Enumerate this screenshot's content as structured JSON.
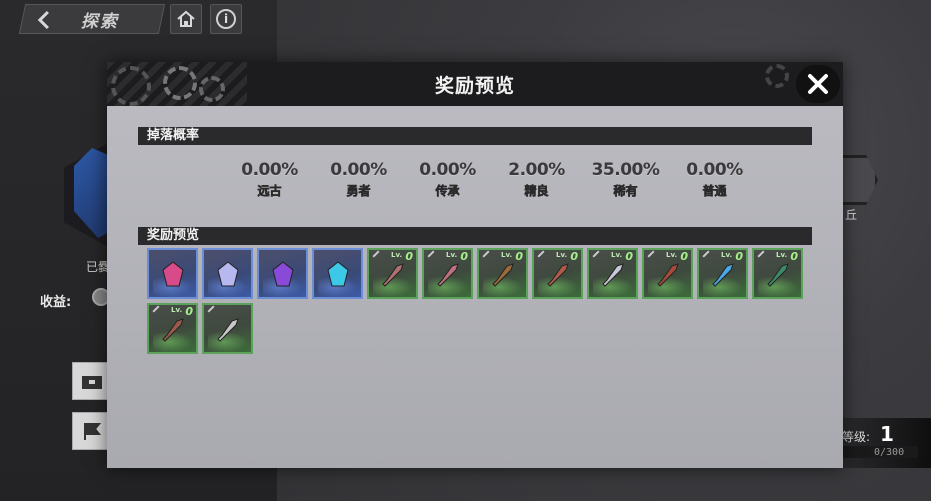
{
  "background": {
    "back_label": "探索",
    "status_text": "已爨",
    "income_label": "收益:",
    "right_label": "丘",
    "level_label": "等级:",
    "level_value": "1",
    "level_exp": "0/300"
  },
  "dialog": {
    "title": "奖励预览",
    "drop_section_label": "掉落概率",
    "reward_section_label": "奖励预览",
    "rates": [
      {
        "value": "0.00%",
        "name": "远古",
        "color": "#f0a21e"
      },
      {
        "value": "0.00%",
        "name": "勇者",
        "color": "#f0c21e"
      },
      {
        "value": "0.00%",
        "name": "传承",
        "color": "#b45ae8"
      },
      {
        "value": "2.00%",
        "name": "精良",
        "color": "#5aa84e"
      },
      {
        "value": "35.00%",
        "name": "稀有",
        "color": "#4f86e8"
      },
      {
        "value": "0.00%",
        "name": "普通",
        "color": "#d8d8d8"
      }
    ],
    "items": [
      {
        "tier": "rare",
        "icon": "red-crystal-icon",
        "color": "#d84a8a",
        "lv": "",
        "count": ""
      },
      {
        "tier": "rare",
        "icon": "white-crystal-icon",
        "color": "#b8b8f0",
        "lv": "",
        "count": ""
      },
      {
        "tier": "rare",
        "icon": "purple-crystal-icon",
        "color": "#8a4ad8",
        "lv": "",
        "count": ""
      },
      {
        "tier": "rare",
        "icon": "cyan-crystal-icon",
        "color": "#3ec8e8",
        "lv": "",
        "count": ""
      },
      {
        "tier": "good",
        "icon": "rifle-icon",
        "color": "#b07070",
        "lv": "Lv.",
        "count": "0"
      },
      {
        "tier": "good",
        "icon": "pistol-icon",
        "color": "#c07080",
        "lv": "Lv.",
        "count": "0"
      },
      {
        "tier": "good",
        "icon": "shotgun-icon",
        "color": "#9a6a3a",
        "lv": "Lv.",
        "count": "0"
      },
      {
        "tier": "good",
        "icon": "armor-icon",
        "color": "#b05a4a",
        "lv": "Lv.",
        "count": "0"
      },
      {
        "tier": "good",
        "icon": "sniper-icon",
        "color": "#c8c8d8",
        "lv": "Lv.",
        "count": "0"
      },
      {
        "tier": "good",
        "icon": "gloves-icon",
        "color": "#a84a3a",
        "lv": "Lv.",
        "count": "0"
      },
      {
        "tier": "good",
        "icon": "blade-icon",
        "color": "#4aa8e8",
        "lv": "Lv.",
        "count": "0"
      },
      {
        "tier": "good",
        "icon": "amulet-icon",
        "color": "#3a8a6a",
        "lv": "Lv.",
        "count": "0"
      },
      {
        "tier": "good",
        "icon": "bracer-icon",
        "color": "#9a5a4a",
        "lv": "Lv.",
        "count": "0"
      },
      {
        "tier": "good",
        "icon": "wire-icon",
        "color": "#c8c8c8",
        "lv": "",
        "count": ""
      }
    ]
  }
}
